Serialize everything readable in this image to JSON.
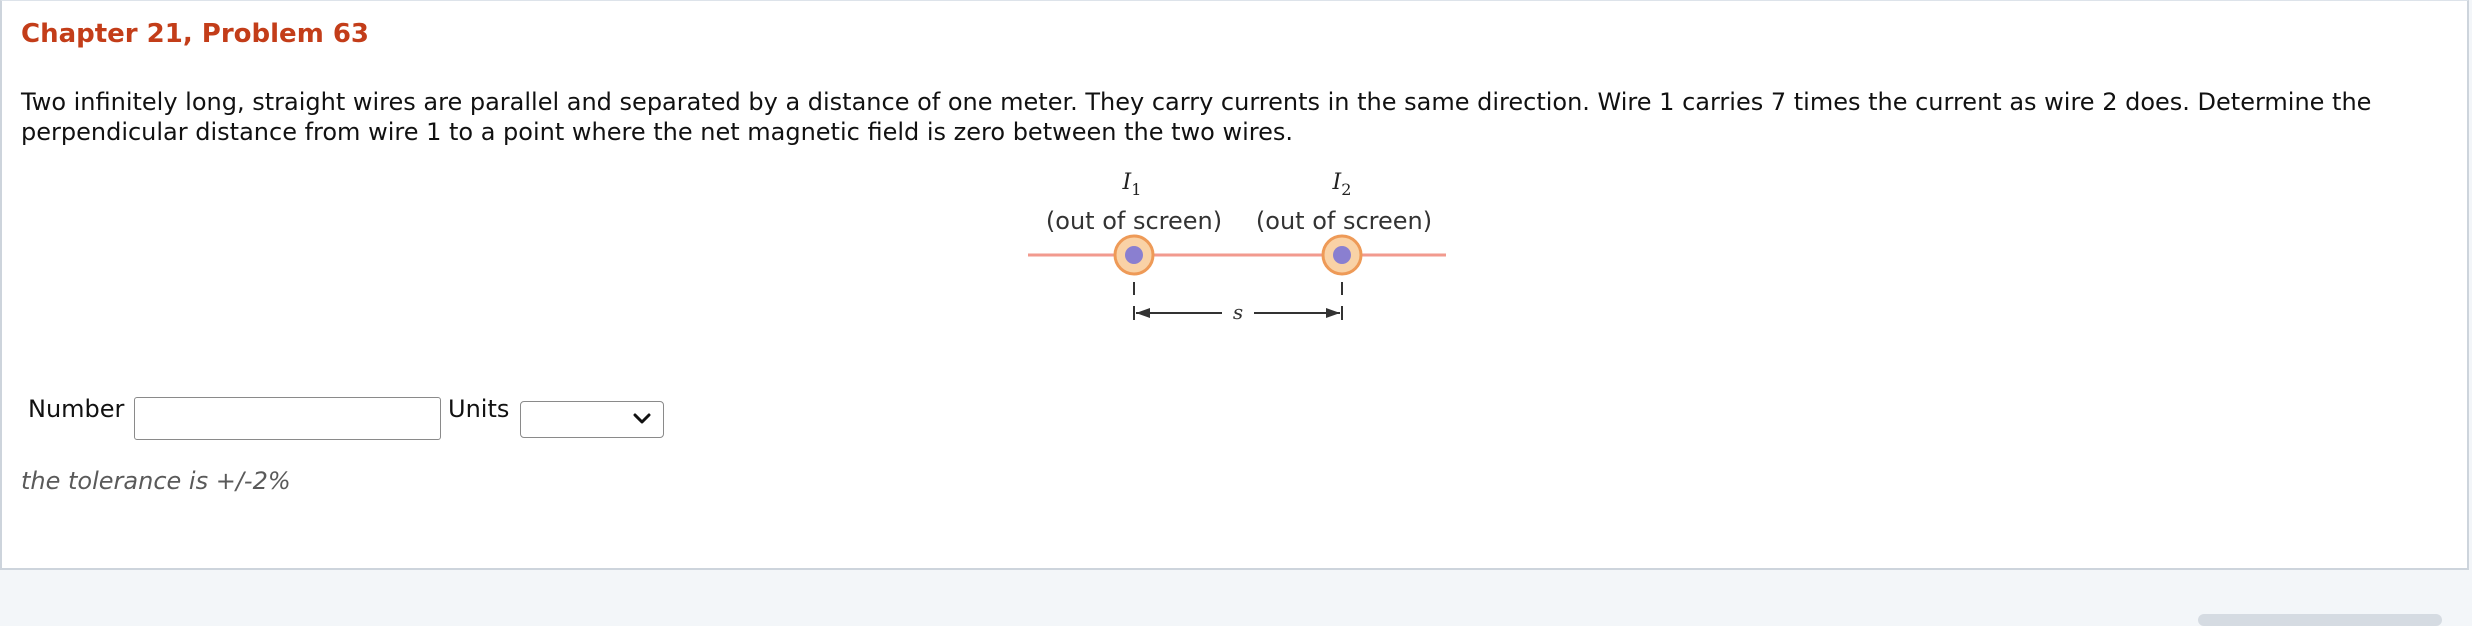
{
  "header": {
    "title": "Chapter 21, Problem 63"
  },
  "problem": {
    "line1": "Two infinitely long, straight wires are parallel and separated by a distance of one meter. They carry currents in the same direction. Wire 1 carries 7 times the current as wire 2 does. Determine the",
    "line2": "perpendicular distance from wire 1 to a point where the net magnetic field is zero between the two wires."
  },
  "figure": {
    "wire1_symbol": "I",
    "wire1_subscript": "1",
    "wire1_direction": "(out of screen)",
    "wire2_symbol": "I",
    "wire2_subscript": "2",
    "wire2_direction": "(out of screen)",
    "separation_label": "s",
    "colors": {
      "line": "#f29a8e",
      "wire_ring": "#f0b07c",
      "wire_core": "#8a7fd0"
    }
  },
  "answer": {
    "number_label": "Number",
    "number_value": "",
    "units_label": "Units",
    "units_selected": ""
  },
  "tolerance_text": "the tolerance is +/-2%",
  "colors": {
    "title": "#c33d19"
  }
}
